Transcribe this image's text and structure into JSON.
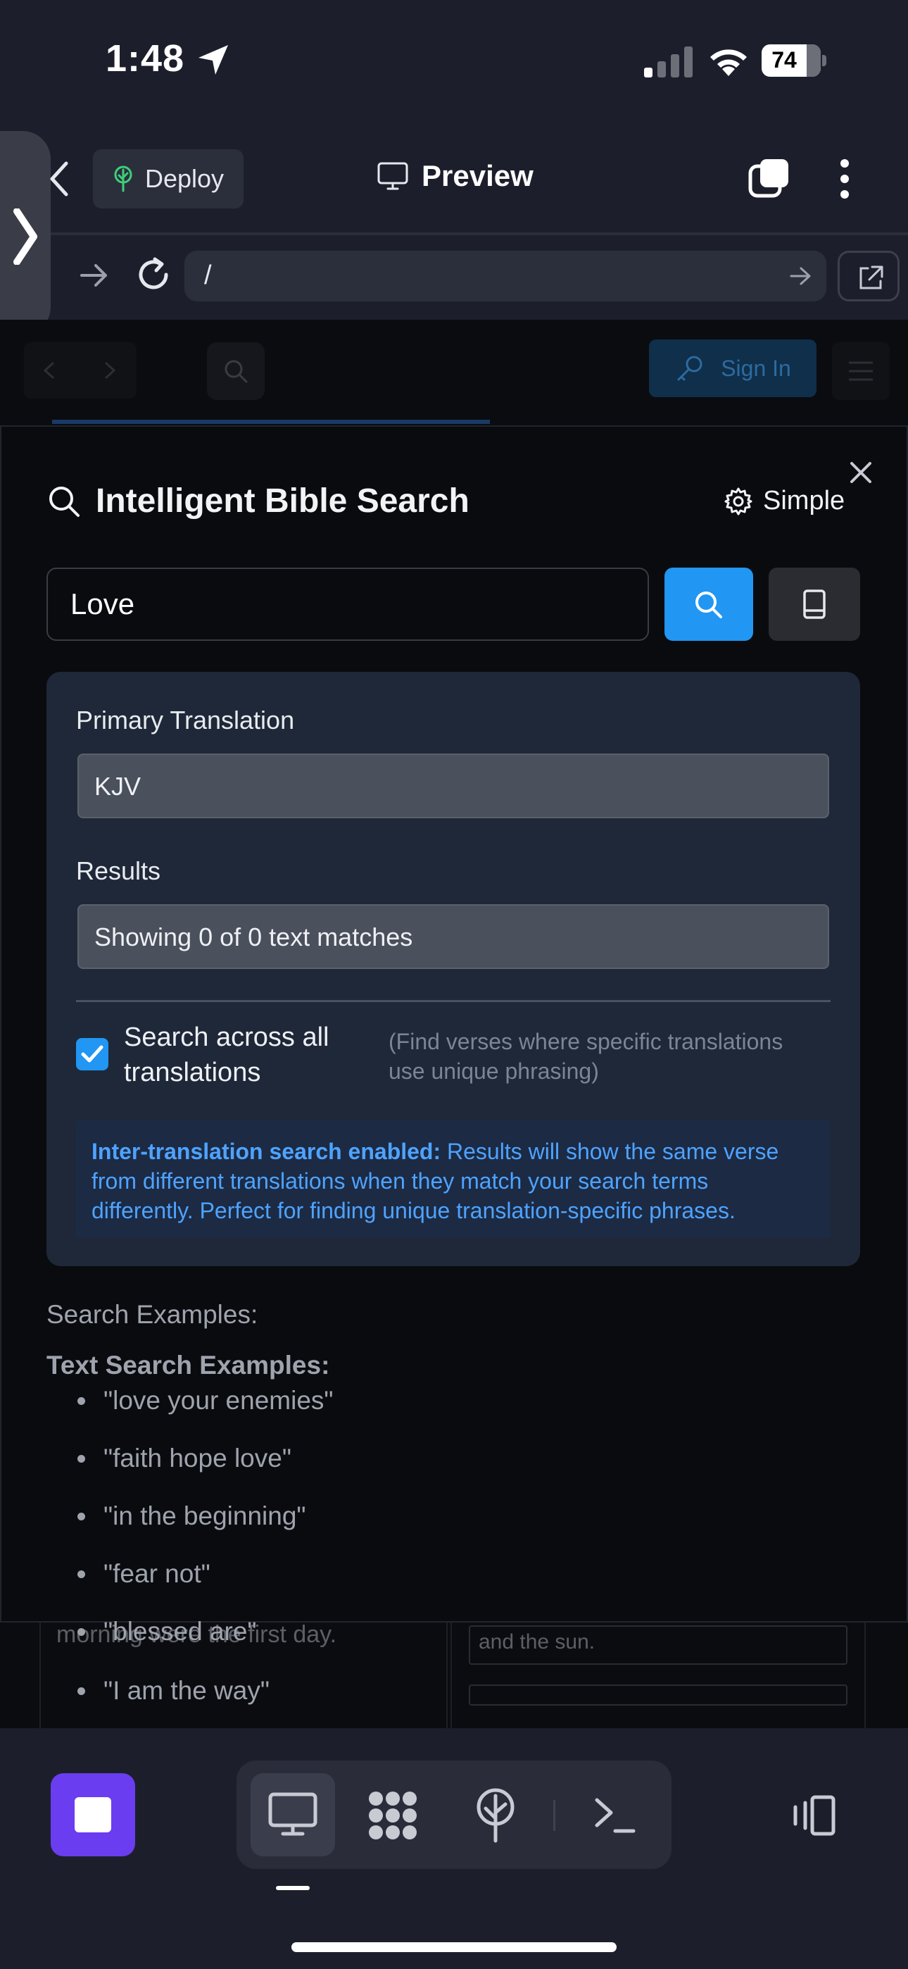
{
  "status_bar": {
    "time": "1:48",
    "battery": "74"
  },
  "top_bar": {
    "deploy_label": "Deploy",
    "preview_label": "Preview"
  },
  "url_bar": {
    "path": "/"
  },
  "app_header": {
    "signin_label": "Sign In"
  },
  "modal": {
    "title": "Intelligent Bible Search",
    "mode_label": "Simple",
    "search": {
      "value": "Love"
    },
    "options": {
      "primary_translation_label": "Primary Translation",
      "primary_translation_value": "KJV",
      "results_label": "Results",
      "results_value": "Showing 0 of 0 text matches",
      "search_all_label": "Search across all translations",
      "search_all_checked": true,
      "search_all_hint": "(Find verses where specific translations use unique phrasing)",
      "info_strong": "Inter-translation search enabled:",
      "info_text": " Results will show the same verse from different translations when they match your search terms differently. Perfect for finding unique translation-specific phrases."
    },
    "examples": {
      "title": "Search Examples:",
      "subtitle": "Text Search Examples:",
      "items": [
        "\"love your enemies\"",
        "\"faith hope love\"",
        "\"in the beginning\"",
        "\"fear not\"",
        "\"blessed are\"",
        "\"I am the way\""
      ]
    }
  },
  "background_content": {
    "left_text": "morning were the first day.",
    "right_text": "and the sun."
  },
  "colors": {
    "accent": "#2196f3",
    "stop_button": "#6a3df0",
    "panel": "#1e2838",
    "info_text": "#4ea3ff"
  },
  "icons": [
    "location-arrow-icon",
    "cellular-signal-icon",
    "wifi-icon",
    "battery-icon",
    "chevron-right-icon",
    "back-chevron-icon",
    "tree-icon",
    "monitor-icon",
    "tabs-icon",
    "more-vertical-icon",
    "forward-arrow-icon",
    "reload-icon",
    "external-link-icon",
    "search-icon",
    "key-icon",
    "hamburger-icon",
    "close-icon",
    "gear-icon",
    "book-icon",
    "checkmark-icon",
    "stop-icon",
    "desktop-icon",
    "apps-icon",
    "deploy-icon",
    "terminal-icon",
    "devices-icon"
  ]
}
